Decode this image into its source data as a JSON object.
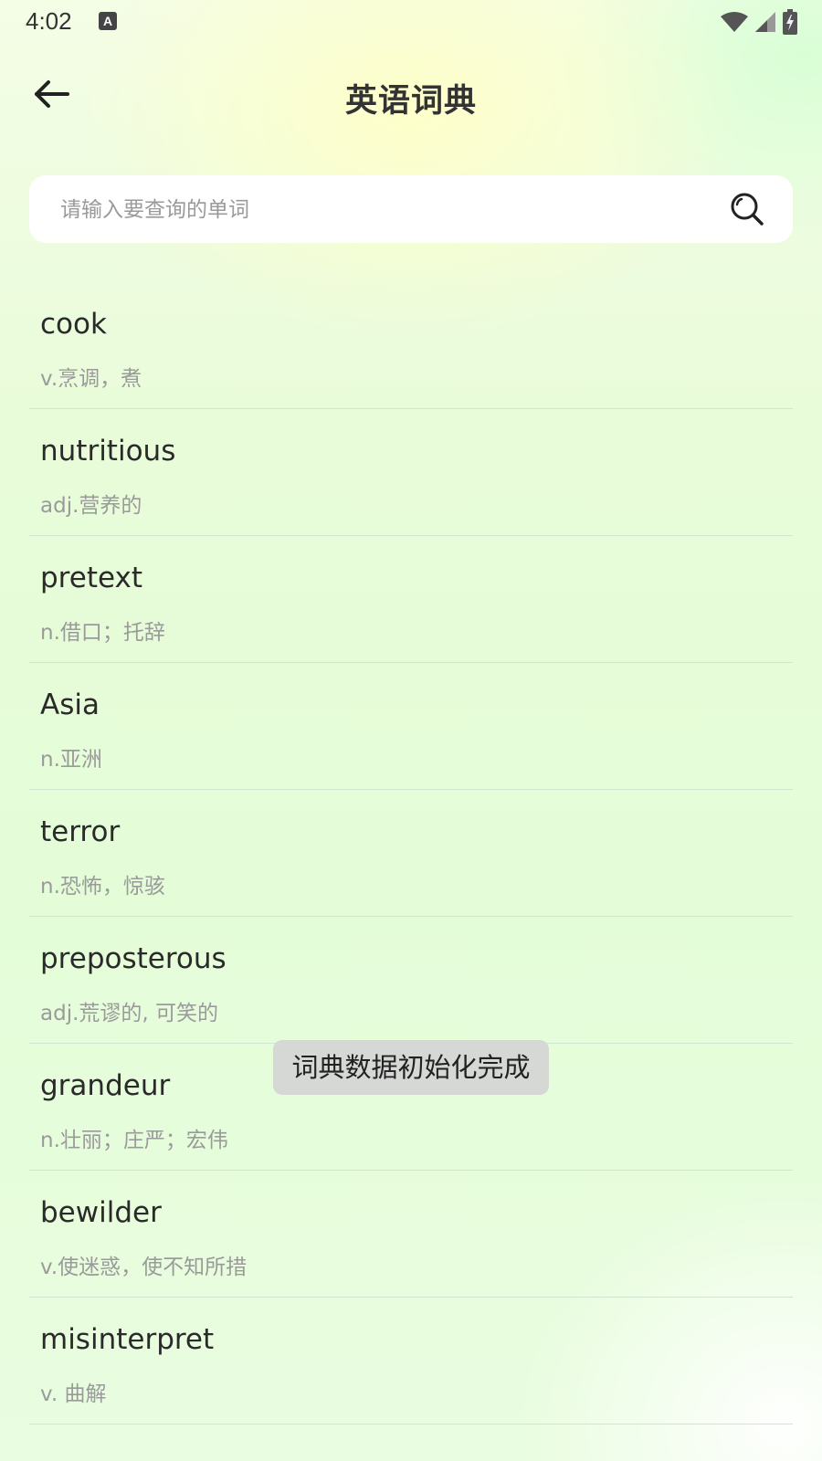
{
  "status_bar": {
    "time": "4:02",
    "notification_icon_letter": "A",
    "icons": [
      "wifi-icon",
      "signal-icon",
      "battery-charging-icon"
    ]
  },
  "header": {
    "back_icon": "arrow-left-icon",
    "title": "英语词典"
  },
  "search": {
    "placeholder": "请输入要查询的单词",
    "value": "",
    "icon": "search-icon"
  },
  "words": [
    {
      "word": "cook",
      "definition": "v.烹调，煮"
    },
    {
      "word": "nutritious",
      "definition": "adj.营养的"
    },
    {
      "word": "pretext",
      "definition": "n.借口；托辞"
    },
    {
      "word": "Asia",
      "definition": "n.亚洲"
    },
    {
      "word": "terror",
      "definition": "n.恐怖，惊骇"
    },
    {
      "word": "preposterous",
      "definition": "adj.荒谬的, 可笑的"
    },
    {
      "word": "grandeur",
      "definition": "n.壮丽；庄严；宏伟"
    },
    {
      "word": "bewilder",
      "definition": "v.使迷惑，使不知所措"
    },
    {
      "word": "misinterpret",
      "definition": "v. 曲解"
    }
  ],
  "toast": {
    "message": "词典数据初始化完成"
  },
  "colors": {
    "background_top": "#f4fde6",
    "background_mid": "#e4fdd8",
    "toast_bg": "#d6d8d6",
    "word_text": "#2a2a2a",
    "definition_text": "#9a9a9a"
  }
}
